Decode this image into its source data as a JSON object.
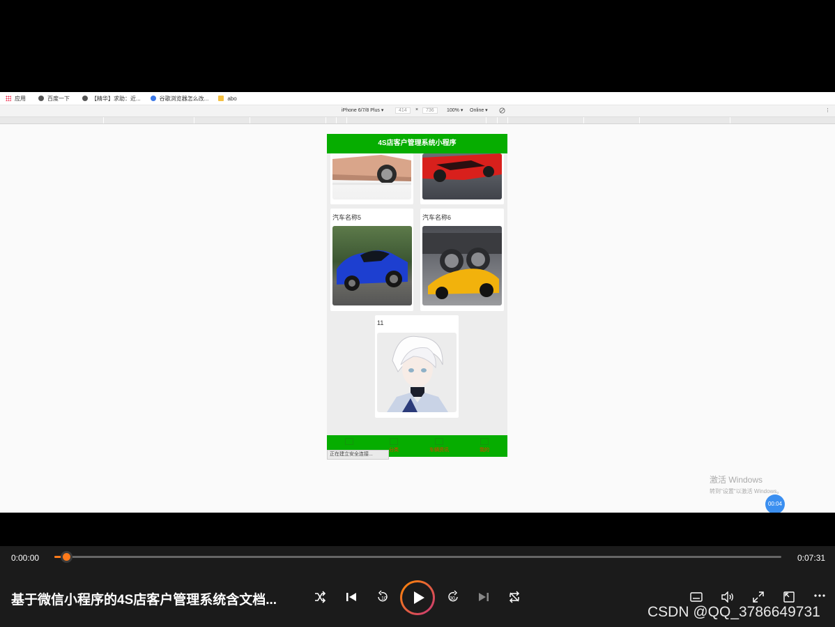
{
  "browser": {
    "bookmarks": [
      {
        "label": "应用",
        "icon": "apps-icon"
      },
      {
        "label": "百度一下",
        "icon": "globe-icon"
      },
      {
        "label": "【精华】求助：近...",
        "icon": "globe-icon"
      },
      {
        "label": "谷歌浏览器怎么改...",
        "icon": "paw-icon"
      },
      {
        "label": "abo",
        "icon": "folder-icon"
      }
    ],
    "device_toolbar": {
      "device": "iPhone 6/7/8 Plus ▾",
      "width": "414",
      "times": "×",
      "height": "736",
      "zoom": "100% ▾",
      "network": "Online ▾"
    }
  },
  "app": {
    "header_title": "4S店客户管理系统小程序",
    "cars": [
      {
        "name": ""
      },
      {
        "name": ""
      },
      {
        "name": "汽车名称5"
      },
      {
        "name": "汽车名称6"
      },
      {
        "name": "11"
      }
    ],
    "tabs": [
      {
        "label": "首页"
      },
      {
        "label": "分类"
      },
      {
        "label": "车辆资讯"
      },
      {
        "label": "我的"
      }
    ],
    "status_toast": "正在建立安全连接..."
  },
  "watermark": {
    "line1": "激活 Windows",
    "line2": "转到\"设置\"以激活 Windows。"
  },
  "timer_bubble": "00:04",
  "player": {
    "current_time": "0:00:00",
    "total_time": "0:07:31",
    "progress": 0.01,
    "title": "基于微信小程序的4S店客户管理系统含文档...",
    "accent_color": "#ff7a1a",
    "controls": [
      "shuffle-icon",
      "prev-icon",
      "rewind-10-icon",
      "play-icon",
      "forward-30-icon",
      "next-icon",
      "repeat-icon",
      "subtitles-icon",
      "volume-icon",
      "fullscreen-icon",
      "pip-icon",
      "more-icon"
    ],
    "credit": "CSDN @QQ_3786649731"
  }
}
